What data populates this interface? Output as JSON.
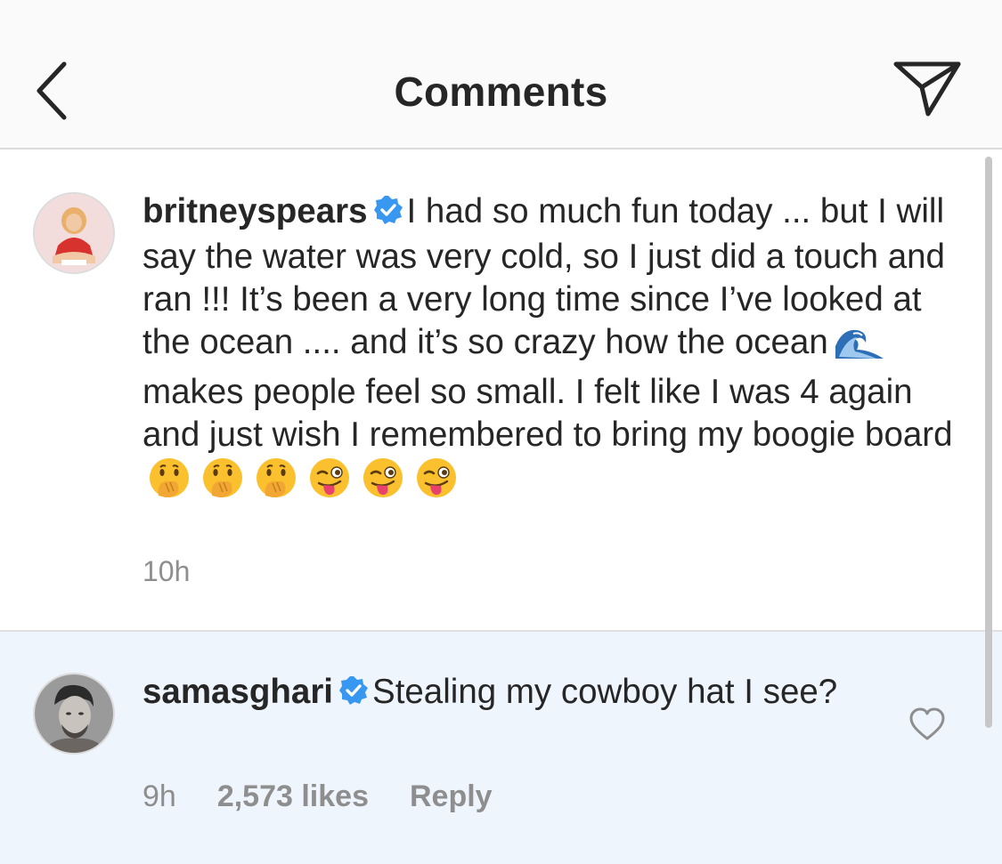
{
  "header": {
    "title": "Comments",
    "back_icon": "chevron-left-icon",
    "send_icon": "paper-plane-icon"
  },
  "caption": {
    "username": "britneyspears",
    "verified": true,
    "text_part1": "I had so much fun today ... but I will say the water was very cold, so I just did a touch and ran !!! It’s been a very long time since I’ve looked at the ocean .... and it’s so crazy how the ocean",
    "text_part2": "makes people feel so small. I felt like I was 4 again and just wish I remembered to bring my boogie board",
    "emojis_inline": [
      "water-wave-emoji"
    ],
    "emojis_trailing": [
      "hand-over-mouth-emoji",
      "hand-over-mouth-emoji",
      "hand-over-mouth-emoji",
      "winking-tongue-emoji",
      "winking-tongue-emoji",
      "winking-tongue-emoji"
    ],
    "time": "10h"
  },
  "comment": {
    "username": "samasghari",
    "verified": true,
    "text": "Stealing my cowboy hat I see?",
    "time": "9h",
    "likes": "2,573 likes",
    "reply_label": "Reply",
    "like_icon": "heart-outline-icon"
  },
  "colors": {
    "verified_blue": "#3897f0",
    "secondary_text": "#8e8e8e",
    "primary_text": "#262626",
    "highlight_bg": "#eff5fd"
  }
}
